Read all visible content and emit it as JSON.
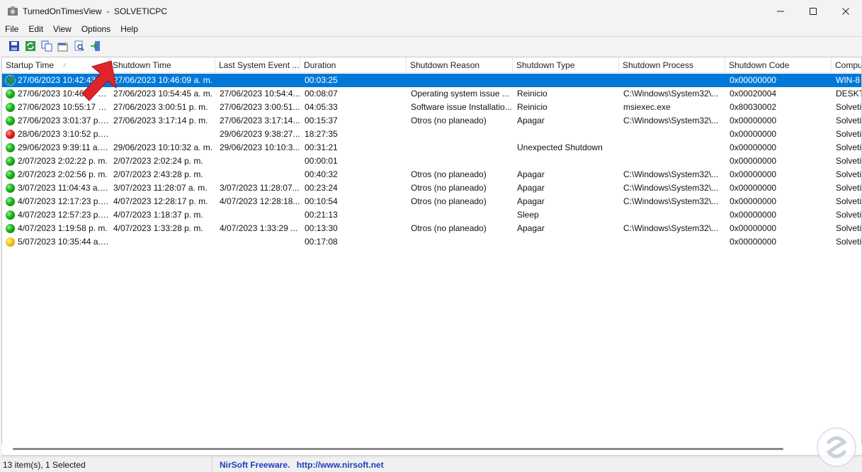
{
  "window": {
    "app_name": "TurnedOnTimesView",
    "computer": "SOLVETICPC",
    "minimize_icon": "minimize-icon",
    "maximize_icon": "maximize-icon",
    "close_icon": "close-icon"
  },
  "menu": [
    "File",
    "Edit",
    "View",
    "Options",
    "Help"
  ],
  "toolbar": {
    "icons": [
      "save-icon",
      "refresh-icon",
      "copy-icon",
      "properties-icon",
      "find-icon",
      "exit-icon"
    ]
  },
  "columns": [
    "Startup Time",
    "Shutdown Time",
    "Last System Event ...",
    "Duration",
    "Shutdown Reason",
    "Shutdown Type",
    "Shutdown Process",
    "Shutdown Code",
    "Compu"
  ],
  "sort_indicator": "⁄",
  "rows": [
    {
      "status": "selected",
      "cells": [
        "27/06/2023 10:42:43 a...",
        "27/06/2023 10:46:09 a. m.",
        "",
        "00:03:25",
        "",
        "",
        "",
        "0x00000000",
        "WIN-8"
      ],
      "selected": true
    },
    {
      "status": "green",
      "cells": [
        "27/06/2023 10:46:27 a...",
        "27/06/2023 10:54:45 a. m.",
        "27/06/2023 10:54:4...",
        "00:08:07",
        "Operating system issue ...",
        "Reinicio",
        "C:\\Windows\\System32\\...",
        "0x00020004",
        "DESKTO"
      ]
    },
    {
      "status": "green",
      "cells": [
        "27/06/2023 10:55:17 a. m.",
        "27/06/2023 3:00:51 p. m.",
        "27/06/2023 3:00:51...",
        "04:05:33",
        "Software issue Installatio...",
        "Reinicio",
        "msiexec.exe",
        "0x80030002",
        "Solveti"
      ]
    },
    {
      "status": "green",
      "cells": [
        "27/06/2023 3:01:37 p. m.",
        "27/06/2023 3:17:14 p. m.",
        "27/06/2023 3:17:14...",
        "00:15:37",
        "Otros (no planeado)",
        "Apagar",
        "C:\\Windows\\System32\\...",
        "0x00000000",
        "Solveti"
      ]
    },
    {
      "status": "red",
      "cells": [
        "28/06/2023 3:10:52 p. ...",
        "",
        "29/06/2023 9:38:27...",
        "18:27:35",
        "",
        "",
        "",
        "0x00000000",
        "Solveti"
      ]
    },
    {
      "status": "green",
      "cells": [
        "29/06/2023 9:39:11 a. m.",
        "29/06/2023 10:10:32 a. m.",
        "29/06/2023 10:10:3...",
        "00:31:21",
        "",
        "Unexpected Shutdown",
        "",
        "0x00000000",
        "Solveti"
      ]
    },
    {
      "status": "green",
      "cells": [
        "2/07/2023 2:02:22 p. m.",
        "2/07/2023 2:02:24 p. m.",
        "",
        "00:00:01",
        "",
        "",
        "",
        "0x00000000",
        "Solveti"
      ]
    },
    {
      "status": "green",
      "cells": [
        "2/07/2023 2:02:56 p. m.",
        "2/07/2023 2:43:28 p. m.",
        "",
        "00:40:32",
        "Otros (no planeado)",
        "Apagar",
        "C:\\Windows\\System32\\...",
        "0x00000000",
        "Solveti"
      ]
    },
    {
      "status": "green",
      "cells": [
        "3/07/2023 11:04:43 a. m.",
        "3/07/2023 11:28:07 a. m.",
        "3/07/2023 11:28:07...",
        "00:23:24",
        "Otros (no planeado)",
        "Apagar",
        "C:\\Windows\\System32\\...",
        "0x00000000",
        "Solveti"
      ]
    },
    {
      "status": "green",
      "cells": [
        "4/07/2023 12:17:23 p. m.",
        "4/07/2023 12:28:17 p. m.",
        "4/07/2023 12:28:18...",
        "00:10:54",
        "Otros (no planeado)",
        "Apagar",
        "C:\\Windows\\System32\\...",
        "0x00000000",
        "Solveti"
      ]
    },
    {
      "status": "green",
      "cells": [
        "4/07/2023 12:57:23 p. m.",
        "4/07/2023 1:18:37 p. m.",
        "",
        "00:21:13",
        "",
        "Sleep",
        "",
        "0x00000000",
        "Solveti"
      ]
    },
    {
      "status": "green",
      "cells": [
        "4/07/2023 1:19:58 p. m.",
        "4/07/2023 1:33:28 p. m.",
        "4/07/2023 1:33:29 ...",
        "00:13:30",
        "Otros (no planeado)",
        "Apagar",
        "C:\\Windows\\System32\\...",
        "0x00000000",
        "Solveti"
      ]
    },
    {
      "status": "yellow",
      "cells": [
        "5/07/2023 10:35:44 a. m.",
        "",
        "",
        "00:17:08",
        "",
        "",
        "",
        "0x00000000",
        "Solveti"
      ]
    }
  ],
  "status": {
    "count_text": "13 item(s), 1 Selected",
    "freeware_text": "NirSoft Freeware.",
    "url_text": "http://www.nirsoft.net"
  },
  "colors": {
    "selection": "#0078d7",
    "status_link": "#1a3fbf",
    "arrow_overlay": "#e0242c"
  },
  "overlay_icons": [
    "red-pointer-arrow-icon",
    "solvetic-watermark-icon"
  ]
}
